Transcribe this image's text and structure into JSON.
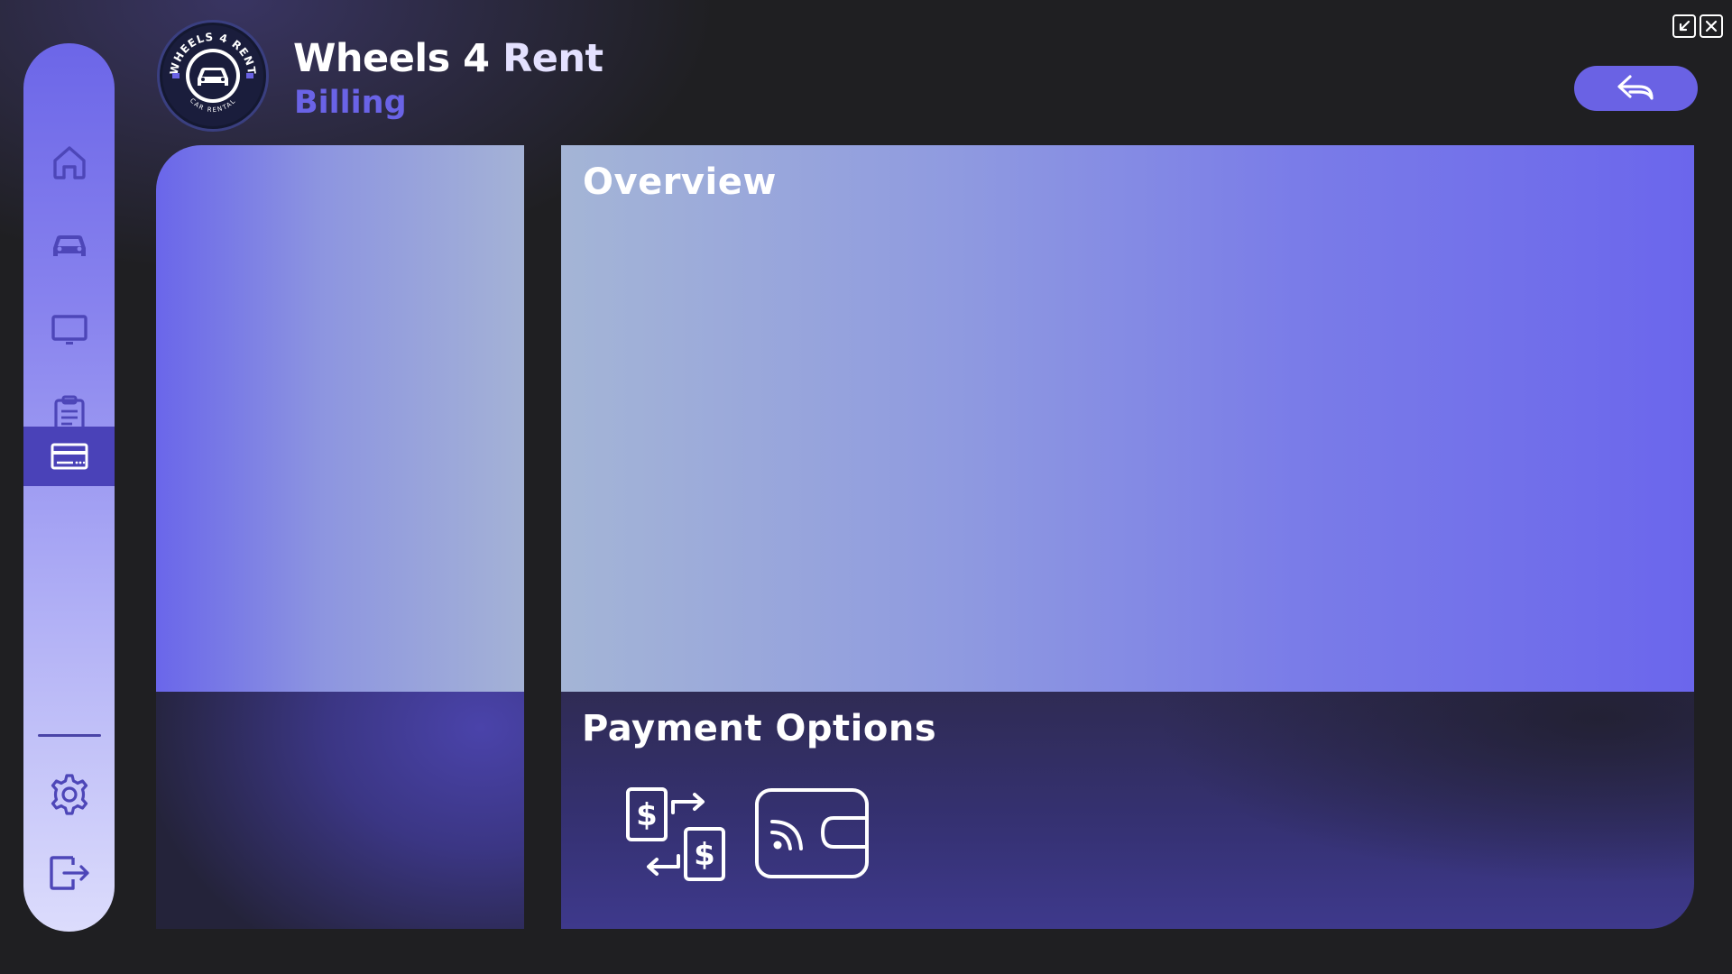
{
  "app": {
    "title_part1": "Wheels 4",
    "title_part2": "Rent",
    "subtitle": "Billing",
    "logo": {
      "arc_text_top": "WHEELS 4 RENT",
      "arc_text_bottom": "CAR RENTAL",
      "icon": "car-icon"
    }
  },
  "window_controls": [
    {
      "name": "minimize-window-icon"
    },
    {
      "name": "close-window-icon"
    }
  ],
  "header": {
    "back_button_icon": "reply-arrow-icon"
  },
  "sidebar": {
    "active_item": "billing",
    "items": [
      {
        "id": "home",
        "icon": "home-icon"
      },
      {
        "id": "cars",
        "icon": "car-icon"
      },
      {
        "id": "display",
        "icon": "monitor-icon"
      },
      {
        "id": "records",
        "icon": "clipboard-icon"
      },
      {
        "id": "billing",
        "icon": "credit-card-icon"
      }
    ],
    "bottom_items": [
      {
        "id": "settings",
        "icon": "gear-icon"
      },
      {
        "id": "logout",
        "icon": "logout-icon"
      }
    ]
  },
  "sections": {
    "overview_title": "Overview",
    "payment_title": "Payment Options",
    "payment_options": [
      {
        "id": "money-exchange",
        "icon": "money-exchange-icon"
      },
      {
        "id": "contactless-card",
        "icon": "contactless-payment-icon"
      }
    ]
  },
  "colors": {
    "background": "#1f1f22",
    "accent": "#6a62e4",
    "sidebar_active": "#4a42b8",
    "subtitle": "#6a63e6"
  }
}
